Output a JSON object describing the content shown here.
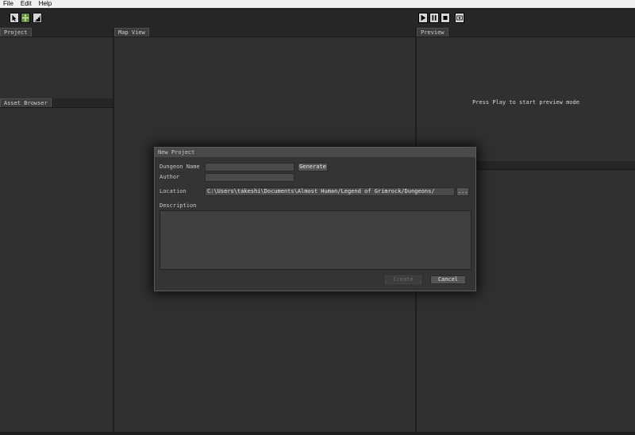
{
  "menu": {
    "items": [
      "File",
      "Edit",
      "Help"
    ]
  },
  "toolbar": {
    "left_tools": [
      "select-tool-icon",
      "move-tool-icon",
      "stairs-tool-icon"
    ],
    "right_tools": [
      "play-icon",
      "pause-icon",
      "stop-icon",
      "eye-icon"
    ]
  },
  "panels": {
    "project": {
      "tab": "Project"
    },
    "asset_browser": {
      "tab": "Asset Browser"
    },
    "map_view": {
      "tab": "Map View"
    },
    "preview": {
      "tab": "Preview",
      "message": "Press Play to start preview mode"
    }
  },
  "dialog": {
    "title": "New Project",
    "dungeon_name": {
      "label": "Dungeon Name",
      "value": ""
    },
    "generate_label": "Generate",
    "author": {
      "label": "Author",
      "value": ""
    },
    "location": {
      "label": "Location",
      "value": "C:\\Users\\takeshi\\Documents\\Almost Human/Legend of Grimrock/Dungeons/"
    },
    "browse_label": "...",
    "description": {
      "label": "Description",
      "value": ""
    },
    "create_label": "Create",
    "cancel_label": "Cancel"
  },
  "colors": {
    "background": "#2f2f2f",
    "panel_tab": "#3c3c3c",
    "dialog": "#343434",
    "dialog_title": "#4a4a4a"
  }
}
